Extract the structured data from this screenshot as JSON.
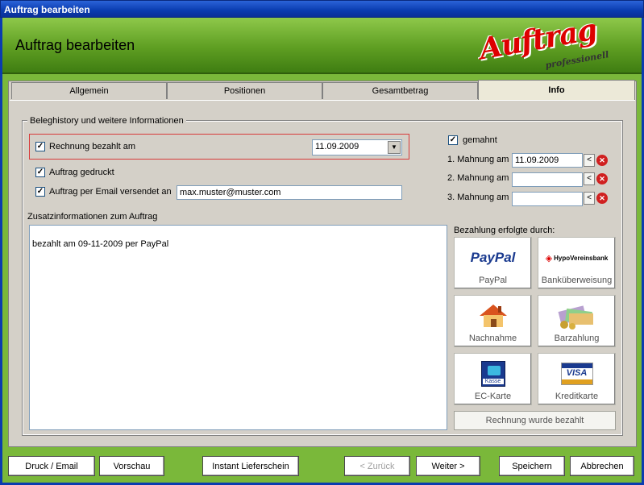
{
  "window": {
    "title": "Auftrag bearbeiten"
  },
  "header": {
    "title": "Auftrag bearbeiten",
    "logo_main": "Auftrag",
    "logo_sub": "professionell"
  },
  "tabs": [
    {
      "label": "Allgemein"
    },
    {
      "label": "Positionen"
    },
    {
      "label": "Gesamtbetrag"
    },
    {
      "label": "Info"
    }
  ],
  "info": {
    "group_label": "Beleghistory und weitere Informationen",
    "paid": {
      "label": "Rechnung bezahlt am",
      "checked": true,
      "date": "11.09.2009"
    },
    "printed": {
      "label": "Auftrag gedruckt",
      "checked": true
    },
    "emailed": {
      "label": "Auftrag per Email versendet an",
      "checked": true,
      "email": "max.muster@muster.com"
    },
    "reminded": {
      "label": "gemahnt",
      "checked": true
    },
    "reminders": [
      {
        "label": "1. Mahnung am",
        "date": "11.09.2009"
      },
      {
        "label": "2. Mahnung am",
        "date": ""
      },
      {
        "label": "3. Mahnung am",
        "date": ""
      }
    ],
    "notes_label": "Zusatzinformationen zum Auftrag",
    "notes": "bezahlt am 09-11-2009 per PayPal",
    "payment_label": "Bezahlung erfolgte durch:",
    "payment_methods": [
      {
        "label": "PayPal",
        "logo": "PayPal"
      },
      {
        "label": "Banküberweisung",
        "logo": "HypoVereinsbank"
      },
      {
        "label": "Nachnahme",
        "logo": ""
      },
      {
        "label": "Barzahlung",
        "logo": ""
      },
      {
        "label": "EC-Karte",
        "logo": "Kasse"
      },
      {
        "label": "Kreditkarte",
        "logo": "VISA"
      }
    ],
    "paid_button": "Rechnung wurde bezahlt"
  },
  "footer": {
    "print_email": "Druck / Email",
    "preview": "Vorschau",
    "instant": "Instant Lieferschein",
    "back": "< Zurück",
    "next": "Weiter >",
    "save": "Speichern",
    "cancel": "Abbrechen"
  },
  "colors": {
    "accent_green": "#7ab83a",
    "title_blue": "#0a3cb0",
    "highlight_red": "#d83a3a"
  }
}
